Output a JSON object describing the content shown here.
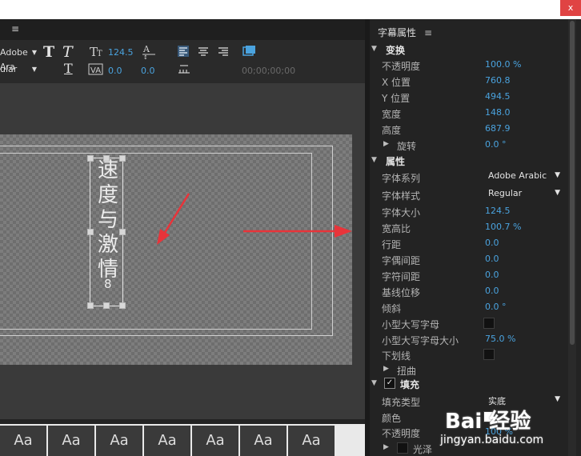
{
  "window": {
    "close_label": "x"
  },
  "toolbar": {
    "font_family": "Adobe Ara",
    "font_style": "ular",
    "text_size": "124.5",
    "kerning": "0.0",
    "leading": "0.0",
    "timecode": "00;00;00;00"
  },
  "title_content": {
    "vertical_text": [
      "速",
      "度",
      "与",
      "激",
      "情"
    ],
    "number": "8"
  },
  "panel": {
    "title": "字幕属性",
    "menu_icon": "≡",
    "sections": {
      "transform": "变换",
      "properties": "属性",
      "fill": "填充"
    },
    "transform": [
      {
        "label": "不透明度",
        "value": "100.0 %"
      },
      {
        "label": "X 位置",
        "value": "760.8"
      },
      {
        "label": "Y 位置",
        "value": "494.5"
      },
      {
        "label": "宽度",
        "value": "148.0"
      },
      {
        "label": "高度",
        "value": "687.9"
      },
      {
        "label": "旋转",
        "value": "0.0 °"
      }
    ],
    "font_family_label": "字体系列",
    "font_family_value": "Adobe Arabic",
    "font_style_label": "字体样式",
    "font_style_value": "Regular",
    "properties": [
      {
        "label": "字体大小",
        "value": "124.5"
      },
      {
        "label": "宽高比",
        "value": "100.7 %"
      },
      {
        "label": "行距",
        "value": "0.0"
      },
      {
        "label": "字偶间距",
        "value": "0.0"
      },
      {
        "label": "字符间距",
        "value": "0.0"
      },
      {
        "label": "基线位移",
        "value": "0.0"
      },
      {
        "label": "倾斜",
        "value": "0.0 °"
      }
    ],
    "small_caps_label": "小型大写字母",
    "small_caps_size_label": "小型大写字母大小",
    "small_caps_size_value": "75.0 %",
    "underline_label": "下划线",
    "distort_label": "扭曲",
    "fill_type_label": "填充类型",
    "fill_type_value": "实底",
    "color_label": "颜色",
    "fill_opacity_label": "不透明度",
    "fill_opacity_value": "100 %",
    "sheen_label": "光泽"
  },
  "watermark": {
    "logo": "Bai 经验",
    "url": "jingyan.baidu.com"
  },
  "colors": {
    "accent_blue": "#4aa3df",
    "arrow_red": "#e8343a",
    "bg": "#232323"
  }
}
